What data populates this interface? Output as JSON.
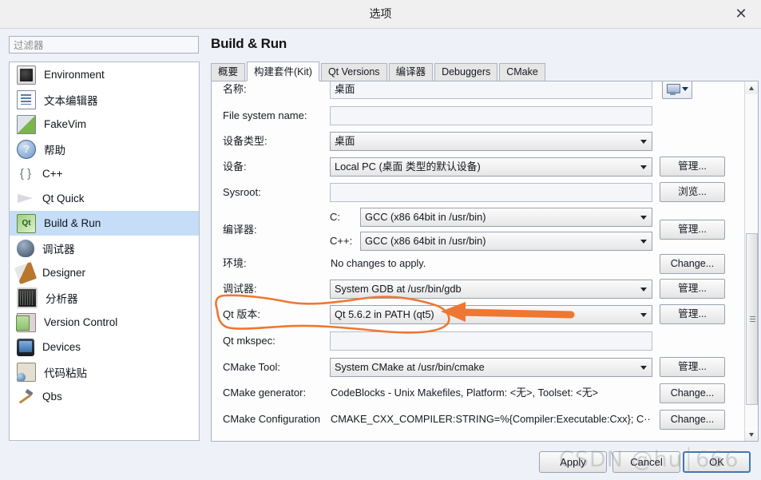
{
  "window": {
    "title": "选项",
    "close_icon": "close-icon"
  },
  "filter": {
    "placeholder": "过滤器",
    "value": ""
  },
  "page": {
    "title": "Build & Run"
  },
  "sidebar": {
    "items": [
      {
        "label": "Environment",
        "icon": "monitor-icon",
        "selected": false
      },
      {
        "label": "文本编辑器",
        "icon": "text-editor-icon",
        "selected": false
      },
      {
        "label": "FakeVim",
        "icon": "fakevim-icon",
        "selected": false
      },
      {
        "label": "帮助",
        "icon": "help-icon",
        "selected": false
      },
      {
        "label": "C++",
        "icon": "braces-icon",
        "selected": false
      },
      {
        "label": "Qt Quick",
        "icon": "paper-plane-icon",
        "selected": false
      },
      {
        "label": "Build & Run",
        "icon": "qt-build-icon",
        "selected": true
      },
      {
        "label": "调试器",
        "icon": "debugger-bug-icon",
        "selected": false
      },
      {
        "label": "Designer",
        "icon": "designer-pen-icon",
        "selected": false
      },
      {
        "label": "分析器",
        "icon": "analyzer-icon",
        "selected": false
      },
      {
        "label": "Version Control",
        "icon": "version-control-icon",
        "selected": false
      },
      {
        "label": "Devices",
        "icon": "device-phone-icon",
        "selected": false
      },
      {
        "label": "代码粘贴",
        "icon": "code-paste-icon",
        "selected": false
      },
      {
        "label": "Qbs",
        "icon": "hammer-icon",
        "selected": false
      }
    ]
  },
  "tabs": [
    {
      "label": "概要",
      "active": false
    },
    {
      "label": "构建套件(Kit)",
      "active": true
    },
    {
      "label": "Qt Versions",
      "active": false
    },
    {
      "label": "编译器",
      "active": false
    },
    {
      "label": "Debuggers",
      "active": false
    },
    {
      "label": "CMake",
      "active": false
    }
  ],
  "form": {
    "name": {
      "label": "名称:",
      "value": "桌面",
      "device_type_button_icon": "monitor-dropdown-icon"
    },
    "file_system_name": {
      "label": "File system name:",
      "value": ""
    },
    "device_type": {
      "label": "设备类型:",
      "value": "桌面"
    },
    "device": {
      "label": "设备:",
      "value": "Local PC (桌面 类型的默认设备)",
      "button": "管理..."
    },
    "sysroot": {
      "label": "Sysroot:",
      "value": "",
      "button": "浏览..."
    },
    "compilers": {
      "label": "编译器:",
      "c_label": "C:",
      "c_value": "GCC (x86 64bit in /usr/bin)",
      "cpp_label": "C++:",
      "cpp_value": "GCC (x86 64bit in /usr/bin)",
      "button": "管理..."
    },
    "environment": {
      "label": "环境:",
      "value": "No changes to apply.",
      "button": "Change..."
    },
    "debugger": {
      "label": "调试器:",
      "value": "System GDB at /usr/bin/gdb",
      "button": "管理..."
    },
    "qt_version": {
      "label": "Qt 版本:",
      "value": "Qt 5.6.2 in PATH (qt5)",
      "button": "管理..."
    },
    "qt_mkspec": {
      "label": "Qt mkspec:",
      "value": ""
    },
    "cmake_tool": {
      "label": "CMake Tool:",
      "value": "System CMake at /usr/bin/cmake",
      "button": "管理..."
    },
    "cmake_generator": {
      "label": "CMake generator:",
      "value": "CodeBlocks - Unix Makefiles, Platform: <无>, Toolset: <无>",
      "button": "Change..."
    },
    "cmake_configuration": {
      "label": "CMake Configuration",
      "value": "CMAKE_CXX_COMPILER:STRING=%{Compiler:Executable:Cxx}; C···",
      "button": "Change..."
    }
  },
  "footer": {
    "apply": "Apply",
    "cancel": "Cancel",
    "ok": "OK"
  },
  "watermark": {
    "text": "CSDN @hu⏐666"
  },
  "annotation": {
    "color": "#ee7733",
    "description": "hand-drawn orange ellipse around Qt version row with arrow pointing at the Qt version combo box"
  }
}
